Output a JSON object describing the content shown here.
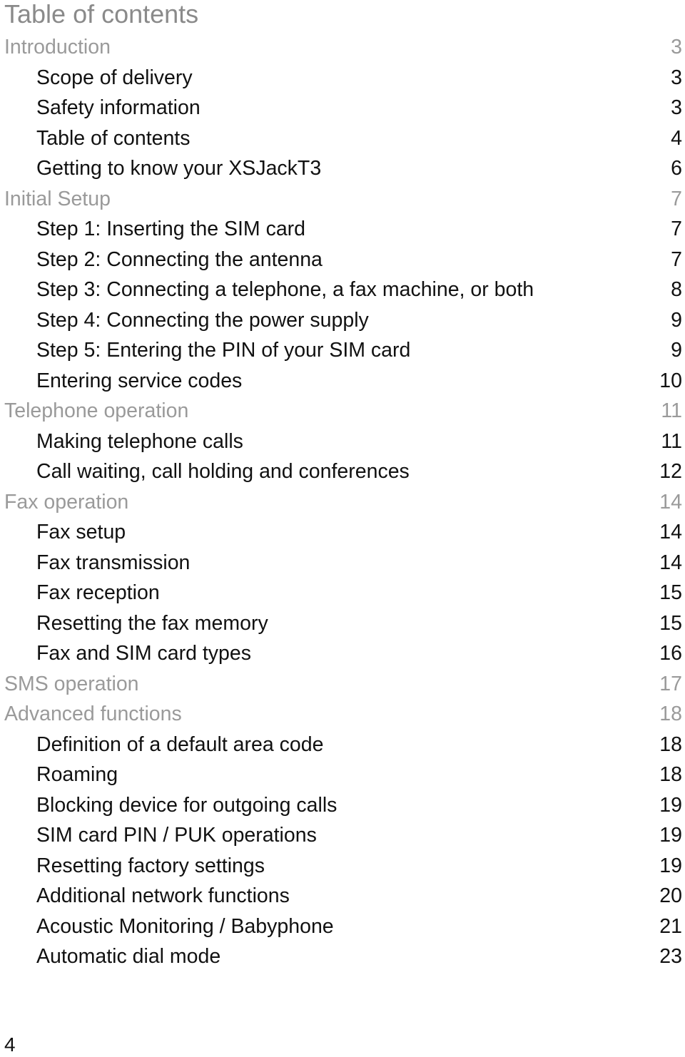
{
  "title": "Table of contents",
  "entries": [
    {
      "label": "Introduction",
      "page": "3",
      "level": "section"
    },
    {
      "label": "Scope of delivery",
      "page": "3",
      "level": "sub"
    },
    {
      "label": "Safety information",
      "page": "3",
      "level": "sub"
    },
    {
      "label": "Table of contents",
      "page": "4",
      "level": "sub"
    },
    {
      "label": "Getting to know your XSJackT3",
      "page": "6",
      "level": "sub"
    },
    {
      "label": "Initial Setup",
      "page": "7",
      "level": "section"
    },
    {
      "label": "Step 1: Inserting the SIM card",
      "page": "7",
      "level": "sub"
    },
    {
      "label": "Step 2: Connecting the antenna",
      "page": "7",
      "level": "sub"
    },
    {
      "label": "Step 3: Connecting a telephone, a fax machine, or both",
      "page": "8",
      "level": "sub"
    },
    {
      "label": "Step 4: Connecting the power supply",
      "page": "9",
      "level": "sub"
    },
    {
      "label": "Step 5: Entering the PIN of your SIM card",
      "page": "9",
      "level": "sub"
    },
    {
      "label": "Entering service codes",
      "page": "10",
      "level": "sub"
    },
    {
      "label": "Telephone operation",
      "page": "11",
      "level": "section"
    },
    {
      "label": "Making telephone calls",
      "page": "11",
      "level": "sub"
    },
    {
      "label": "Call waiting, call holding and conferences",
      "page": "12",
      "level": "sub"
    },
    {
      "label": "Fax operation",
      "page": "14",
      "level": "section"
    },
    {
      "label": "Fax setup",
      "page": "14",
      "level": "sub"
    },
    {
      "label": "Fax transmission",
      "page": "14",
      "level": "sub"
    },
    {
      "label": "Fax reception",
      "page": "15",
      "level": "sub"
    },
    {
      "label": "Resetting the fax memory",
      "page": "15",
      "level": "sub"
    },
    {
      "label": "Fax and SIM card types",
      "page": "16",
      "level": "sub"
    },
    {
      "label": "SMS operation",
      "page": "17",
      "level": "section"
    },
    {
      "label": "Advanced functions",
      "page": "18",
      "level": "section"
    },
    {
      "label": "Definition of a default area code",
      "page": "18",
      "level": "sub"
    },
    {
      "label": "Roaming",
      "page": "18",
      "level": "sub"
    },
    {
      "label": "Blocking device for outgoing calls",
      "page": "19",
      "level": "sub"
    },
    {
      "label": "SIM card PIN / PUK operations",
      "page": "19",
      "level": "sub"
    },
    {
      "label": "Resetting factory settings",
      "page": "19",
      "level": "sub"
    },
    {
      "label": "Additional network functions",
      "page": "20",
      "level": "sub"
    },
    {
      "label": "Acoustic Monitoring / Babyphone",
      "page": "21",
      "level": "sub"
    },
    {
      "label": "Automatic dial mode",
      "page": "23",
      "level": "sub"
    }
  ],
  "footer": {
    "page_number": "4"
  },
  "colors": {
    "heading": "#9a9a9a",
    "title": "#8a8a8a",
    "text": "#111111"
  }
}
